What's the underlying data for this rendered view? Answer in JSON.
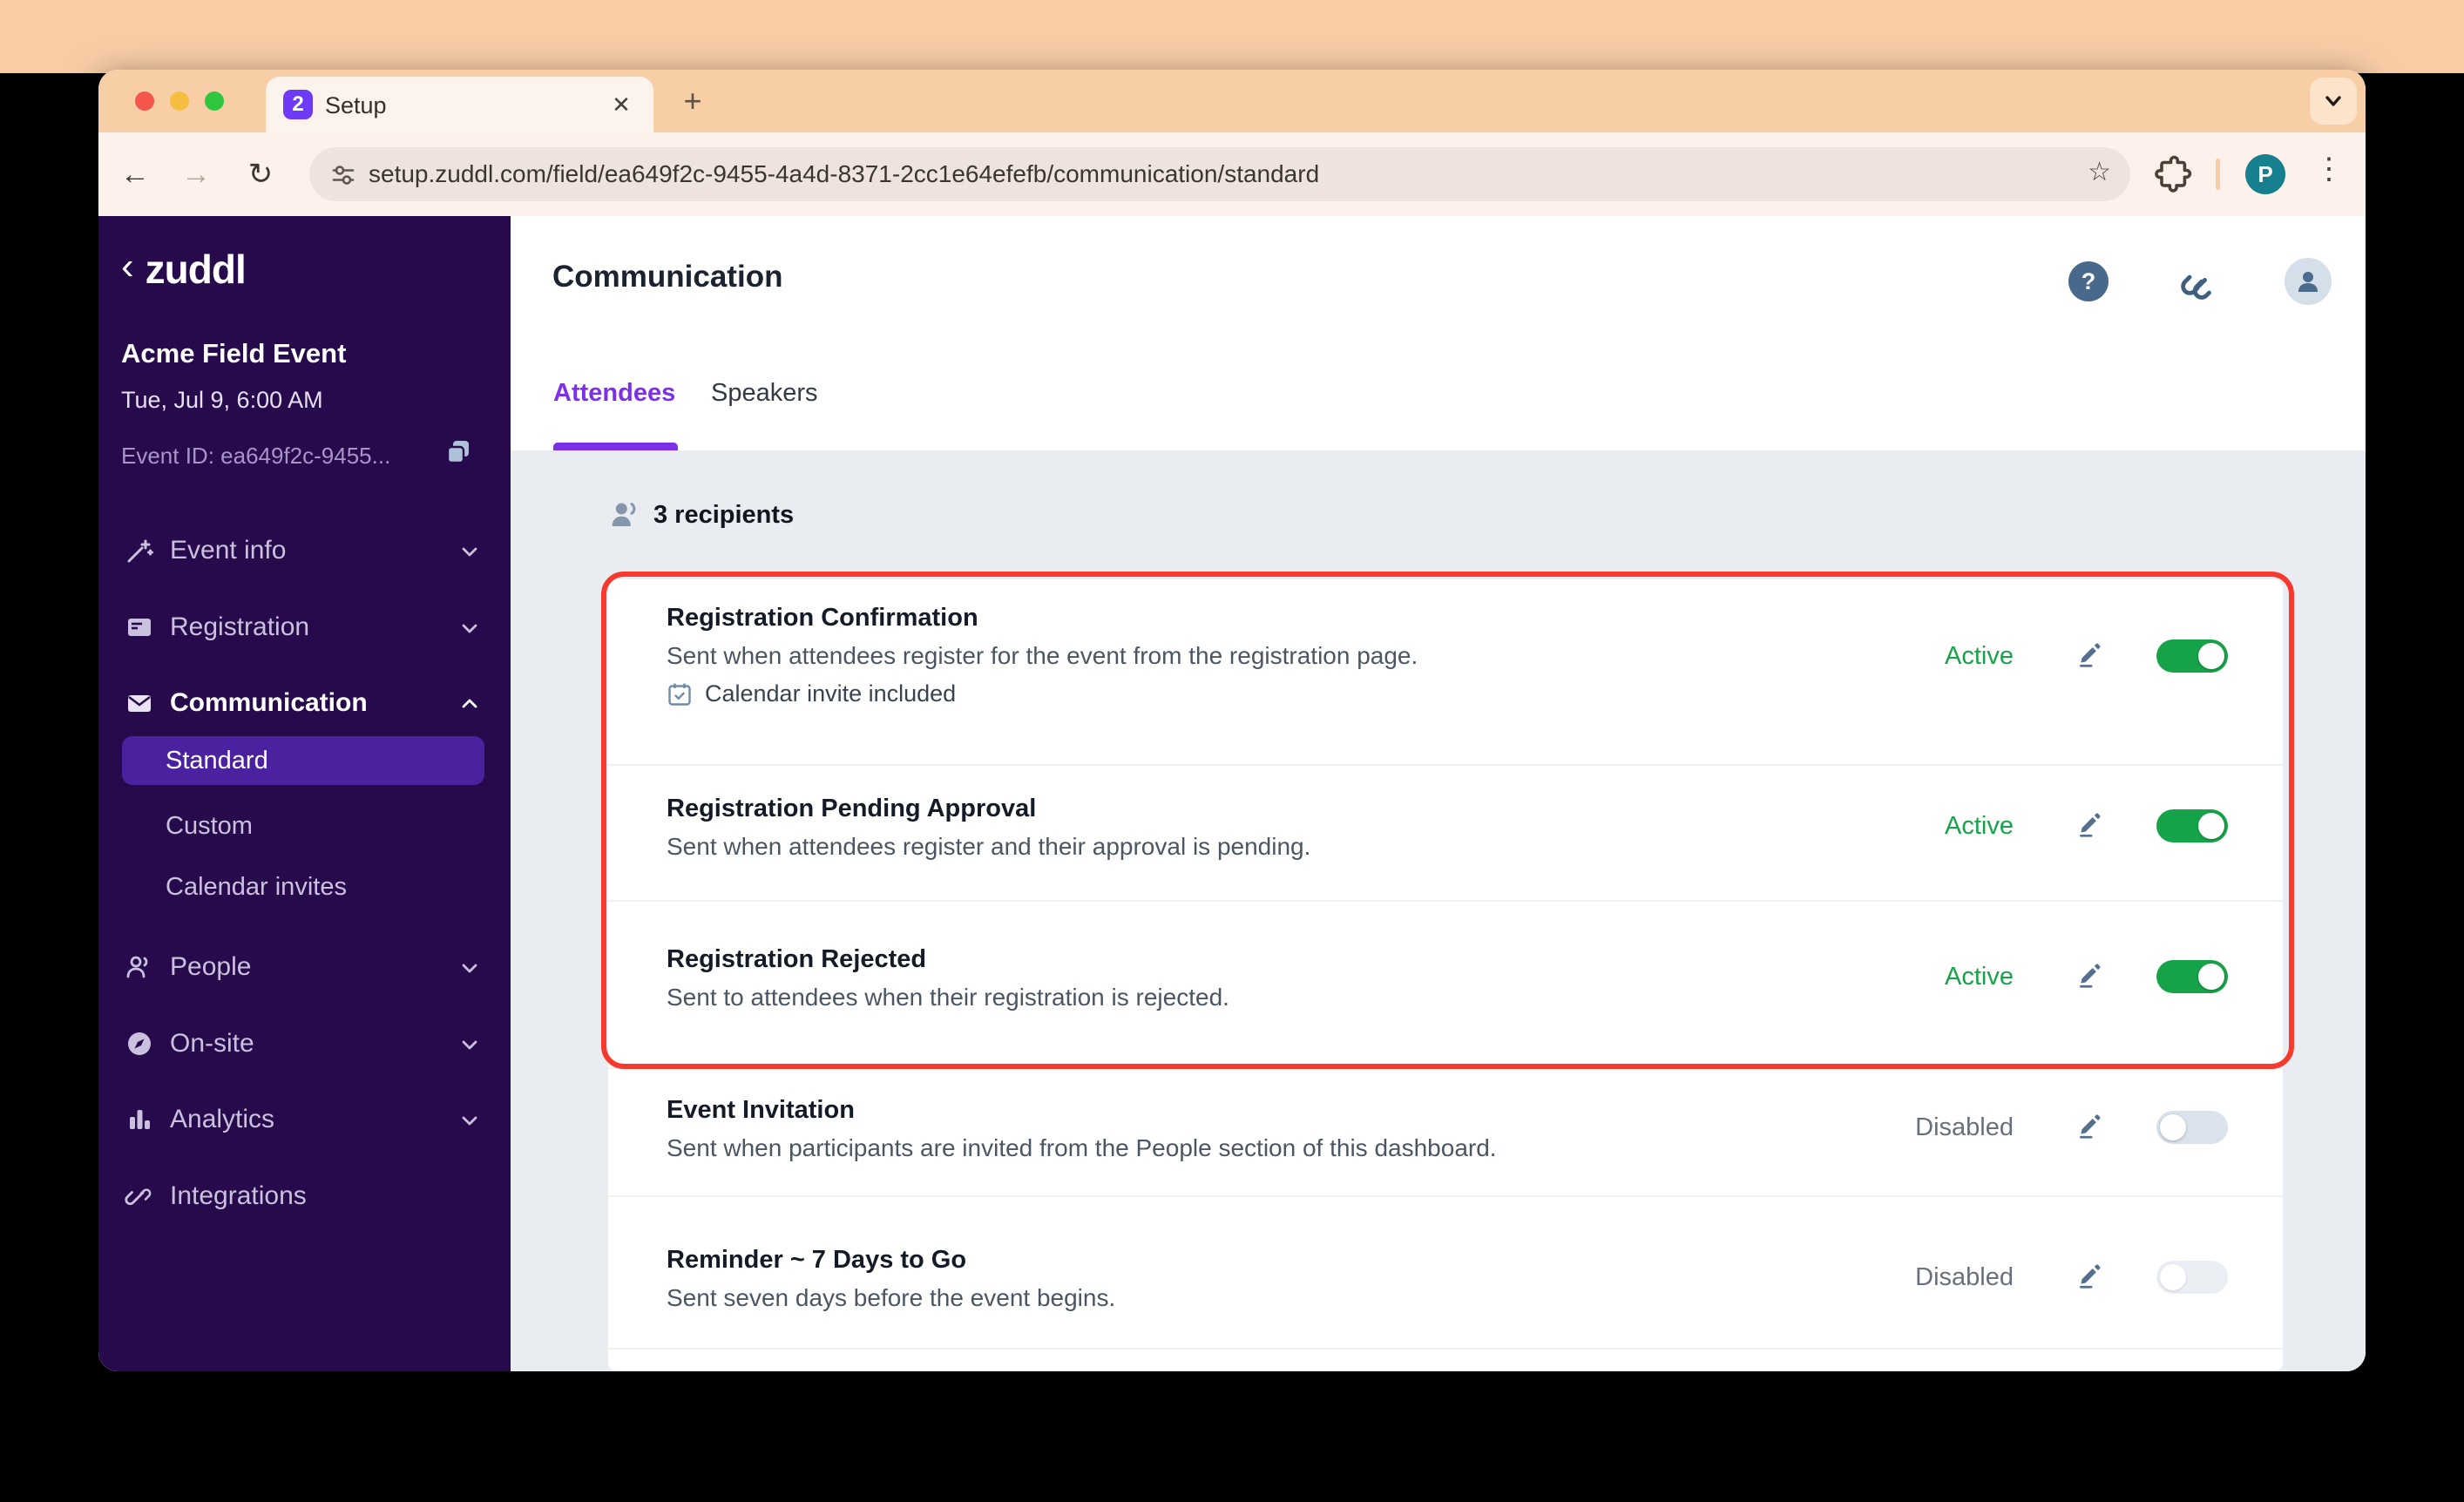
{
  "colors": {
    "accent_purple": "#7c30e8",
    "sidebar_purple": "#270a4c",
    "active_green": "#17a34a",
    "disabled_gray": "#69707b",
    "annotation_red": "#f9392e",
    "toggle_off": "#dbe2eb",
    "tabstrip_peach": "#f8cea7"
  },
  "icons": {
    "favicon": "2",
    "close": "✕",
    "plus": "+",
    "back": "‹",
    "arrow_back": "←",
    "arrow_forward": "→",
    "reload": "↻",
    "star": "☆",
    "overflow": "⋮",
    "help": "?",
    "profile": "P"
  },
  "browser": {
    "tab_title": "Setup",
    "url": "setup.zuddl.com/field/ea649f2c-9455-4a4d-8371-2cc1e64efefb/communication/standard",
    "profile_initial": "P"
  },
  "sidebar": {
    "logo_text": "zuddl",
    "event_name": "Acme Field Event",
    "event_datetime": "Tue, Jul 9, 6:00 AM",
    "event_id": "Event ID: ea649f2c-9455...",
    "nav": [
      {
        "label": "Event info"
      },
      {
        "label": "Registration"
      },
      {
        "label": "Communication"
      },
      {
        "label": "People"
      },
      {
        "label": "On-site"
      },
      {
        "label": "Analytics"
      },
      {
        "label": "Integrations"
      }
    ],
    "communication_children": [
      {
        "label": "Standard",
        "active": true
      },
      {
        "label": "Custom",
        "active": false
      },
      {
        "label": "Calendar invites",
        "active": false
      }
    ]
  },
  "main": {
    "title": "Communication",
    "tabs": [
      {
        "label": "Attendees"
      },
      {
        "label": "Speakers"
      }
    ],
    "recipients": "3 recipients"
  },
  "emails": [
    {
      "title": "Registration Confirmation",
      "description": "Sent when attendees register for the event from the registration page.",
      "badge": "Calendar invite included",
      "status": "Active",
      "enabled": true
    },
    {
      "title": "Registration Pending Approval",
      "description": "Sent when attendees register and their approval is pending.",
      "status": "Active",
      "enabled": true
    },
    {
      "title": "Registration Rejected",
      "description": "Sent to attendees when their registration is rejected.",
      "status": "Active",
      "enabled": true
    },
    {
      "title": "Event Invitation",
      "description": "Sent when participants are invited from the People section of this dashboard.",
      "status": "Disabled",
      "enabled": false
    },
    {
      "title": "Reminder ~ 7 Days to Go",
      "description": "Sent seven days before the event begins.",
      "status": "Disabled",
      "enabled": false
    }
  ]
}
